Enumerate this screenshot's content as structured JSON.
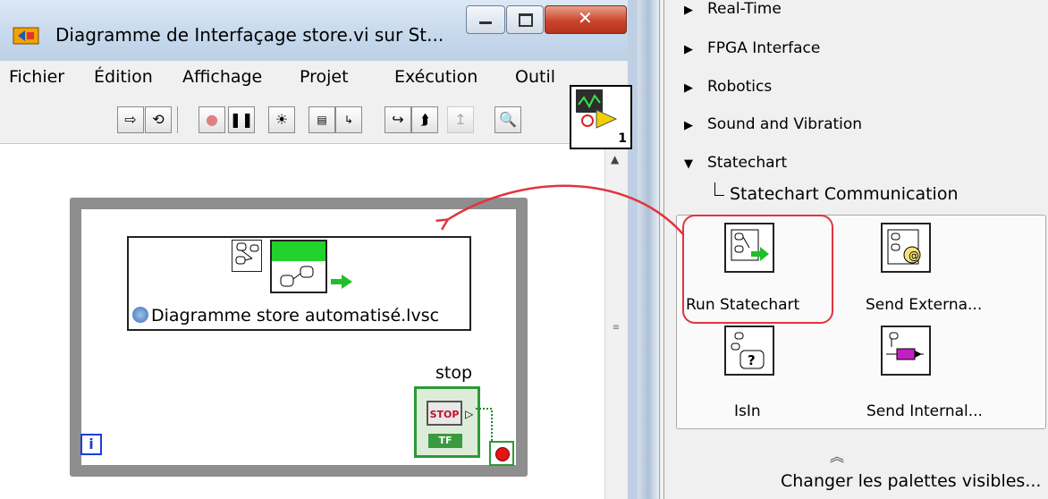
{
  "window": {
    "title": "Diagramme de Interfaçage store.vi sur St...",
    "menu": [
      "Fichier",
      "Édition",
      "Affichage",
      "Projet",
      "Exécution",
      "Outil"
    ],
    "vi_icon_number": "1"
  },
  "toolbar": {
    "icons": [
      "run-arrow-icon",
      "run-continuously-icon",
      "abort-icon",
      "pause-icon",
      "highlight-execution-icon",
      "retain-wire-values-icon",
      "step-into-icon",
      "step-over-icon",
      "step-out-icon",
      "zoom-icon"
    ]
  },
  "diagram": {
    "statechart_file": "Diagramme store automatisé.lvsc",
    "stop_label": "stop",
    "stop_button_text": "STOP",
    "stop_tf": "TF",
    "iteration_terminal": "i"
  },
  "palette": {
    "categories": [
      {
        "label": "Real-Time",
        "expanded": false
      },
      {
        "label": "FPGA Interface",
        "expanded": false
      },
      {
        "label": "Robotics",
        "expanded": false
      },
      {
        "label": "Sound and Vibration",
        "expanded": false
      },
      {
        "label": "Statechart",
        "expanded": true
      }
    ],
    "subcategory": "Statechart Communication",
    "items": [
      {
        "label": "Run Statechart",
        "icon": "run-statechart-icon",
        "highlighted": true
      },
      {
        "label": "Send Externa...",
        "icon": "send-external-icon"
      },
      {
        "label": "IsIn",
        "icon": "isin-icon"
      },
      {
        "label": "Send Internal...",
        "icon": "send-internal-icon"
      }
    ],
    "change_visible": "Changer les palettes visibles..."
  },
  "colors": {
    "annotation_red": "#e0353f",
    "loop_gray": "#8e8e8e",
    "green": "#22d12c"
  }
}
